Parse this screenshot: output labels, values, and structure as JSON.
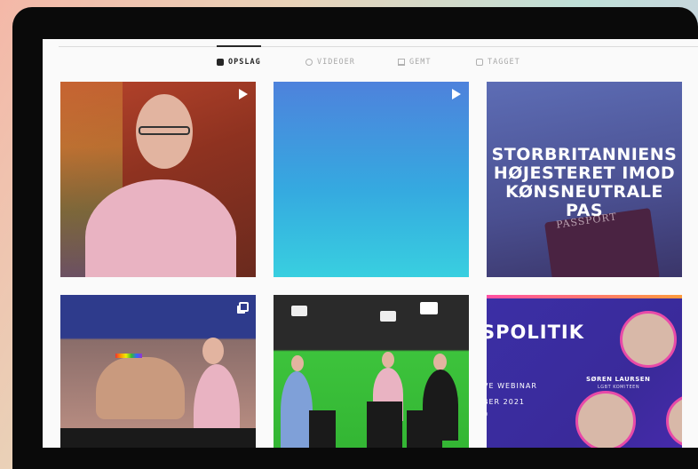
{
  "tabs": [
    {
      "label": "OPSLAG",
      "icon": "grid-icon",
      "active": true
    },
    {
      "label": "VIDEOER",
      "icon": "video-icon",
      "active": false
    },
    {
      "label": "GEMT",
      "icon": "bookmark-icon",
      "active": false
    },
    {
      "label": "TAGGET",
      "icon": "tag-icon",
      "active": false
    }
  ],
  "posts": [
    {
      "type": "video"
    },
    {
      "type": "video"
    },
    {
      "type": "image",
      "title_lines": [
        "STORBRITANNIENS",
        "HØJESTERET IMOD",
        "KØNSNEUTRALE",
        "PAS"
      ],
      "passport_text": "PASSPORT"
    },
    {
      "type": "carousel"
    },
    {
      "type": "image"
    },
    {
      "type": "image",
      "heading": "SPOLITIK",
      "sub_line_1": "VE WEBINAR",
      "sub_line_2": "BER 2021",
      "sub_line_3": "0",
      "speaker_name": "SØREN LAURSEN",
      "speaker_role": "LGBT KOMITEEN"
    }
  ],
  "colors": {
    "accent_pink": "#e84aa8",
    "tab_active": "#262626",
    "tab_inactive": "#a8a8a8"
  }
}
